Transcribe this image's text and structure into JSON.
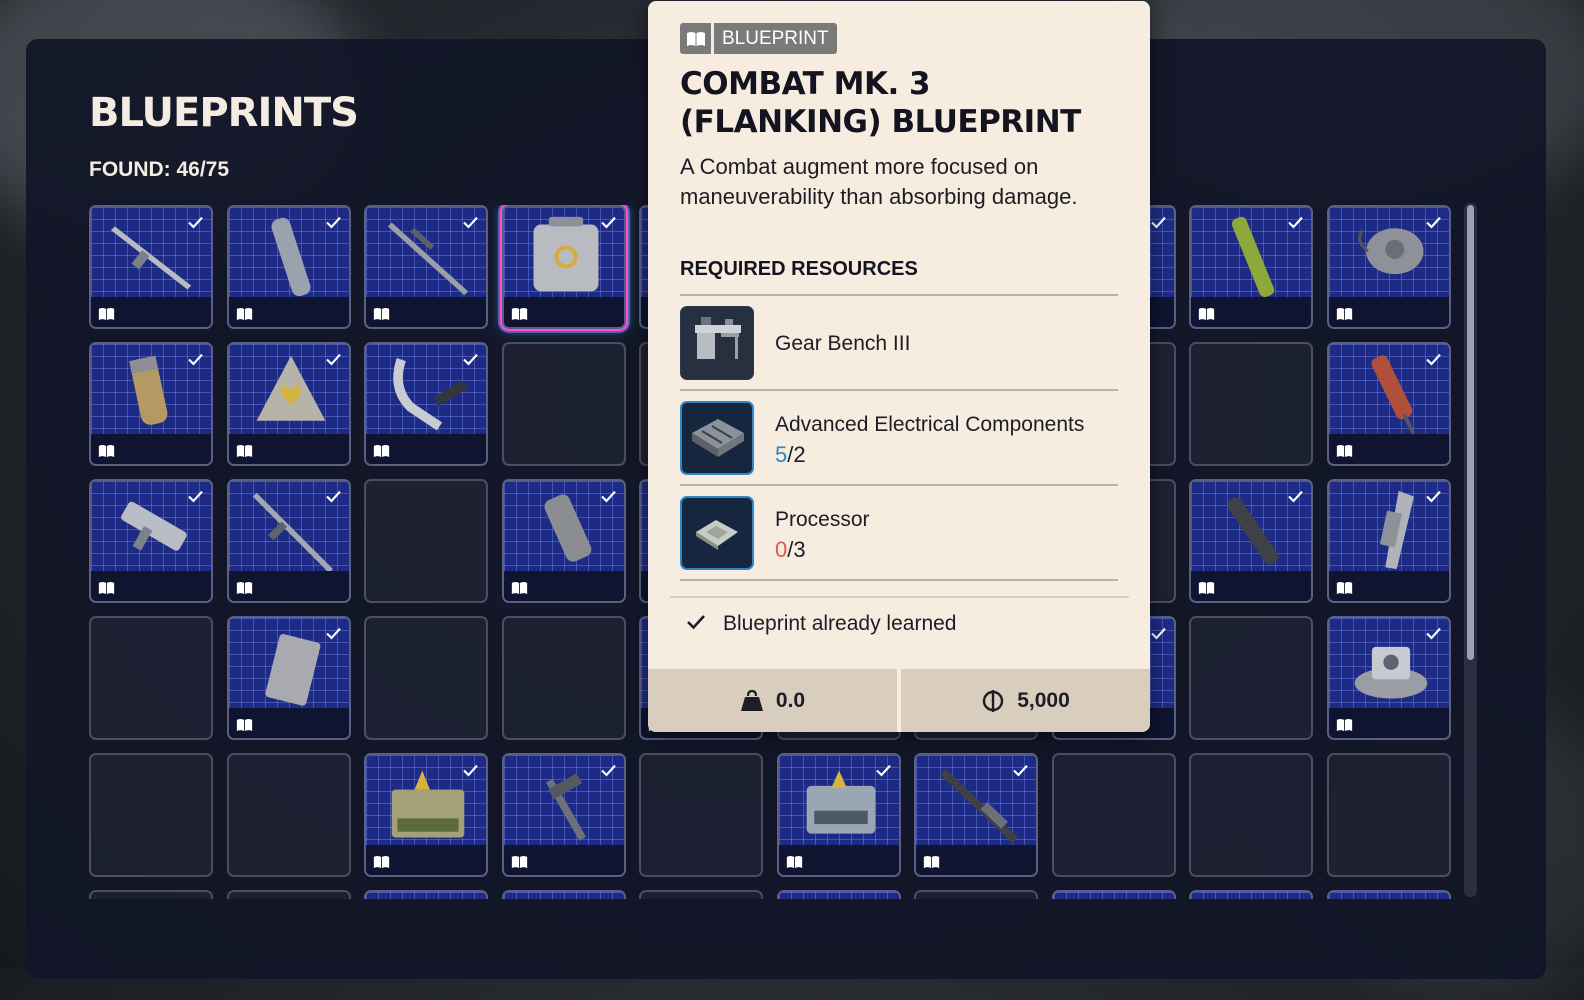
{
  "panel": {
    "title": "BLUEPRINTS",
    "found": "FOUND: 46/75"
  },
  "grid": {
    "cells": [
      {
        "state": "filled",
        "item": "rifle-item"
      },
      {
        "state": "filled",
        "item": "cylinder-item"
      },
      {
        "state": "filled",
        "item": "sniper-item"
      },
      {
        "state": "filled",
        "item": "augment-case-item",
        "selected": true
      },
      {
        "state": "filled",
        "item": "hidden"
      },
      {
        "state": "filled",
        "item": "hidden"
      },
      {
        "state": "filled",
        "item": "hidden"
      },
      {
        "state": "filled",
        "item": "hidden"
      },
      {
        "state": "filled",
        "item": "green-tube-item"
      },
      {
        "state": "filled",
        "item": "mine-item"
      },
      {
        "state": "filled",
        "item": "grenade-item"
      },
      {
        "state": "filled",
        "item": "heart-shield-item"
      },
      {
        "state": "filled",
        "item": "zipline-item"
      },
      {
        "state": "empty"
      },
      {
        "state": "empty"
      },
      {
        "state": "empty"
      },
      {
        "state": "empty"
      },
      {
        "state": "empty"
      },
      {
        "state": "empty"
      },
      {
        "state": "filled",
        "item": "syringe-item"
      },
      {
        "state": "filled",
        "item": "smg-item"
      },
      {
        "state": "filled",
        "item": "long-rifle-item"
      },
      {
        "state": "empty"
      },
      {
        "state": "filled",
        "item": "muzzle-item"
      },
      {
        "state": "filled",
        "item": "hidden"
      },
      {
        "state": "empty"
      },
      {
        "state": "empty"
      },
      {
        "state": "empty"
      },
      {
        "state": "filled",
        "item": "silencer-item"
      },
      {
        "state": "filled",
        "item": "stock-item"
      },
      {
        "state": "empty"
      },
      {
        "state": "filled",
        "item": "magazine-item"
      },
      {
        "state": "empty"
      },
      {
        "state": "empty"
      },
      {
        "state": "filled",
        "item": "hidden"
      },
      {
        "state": "empty"
      },
      {
        "state": "empty"
      },
      {
        "state": "filled",
        "item": "hidden"
      },
      {
        "state": "empty"
      },
      {
        "state": "filled",
        "item": "turret-item"
      },
      {
        "state": "empty"
      },
      {
        "state": "empty"
      },
      {
        "state": "filled",
        "item": "ammo-case-item"
      },
      {
        "state": "filled",
        "item": "hammer-item"
      },
      {
        "state": "empty"
      },
      {
        "state": "filled",
        "item": "tool-case-item"
      },
      {
        "state": "filled",
        "item": "shotgun-item"
      },
      {
        "state": "empty"
      },
      {
        "state": "empty"
      },
      {
        "state": "empty"
      }
    ]
  },
  "tooltip": {
    "tag": "BLUEPRINT",
    "tag_icon": "book-icon",
    "title": "COMBAT MK. 3 (FLANKING) BLUEPRINT",
    "description": "A Combat augment more focused on maneuverability than absorbing damage.",
    "required_label": "REQUIRED RESOURCES",
    "resources": [
      {
        "name": "Gear Bench III",
        "icon": "workbench-icon"
      },
      {
        "name": "Advanced Electrical Components",
        "have": "5",
        "need": "/2",
        "have_color": "#2f86c9",
        "icon": "circuit-tray-icon"
      },
      {
        "name": "Processor",
        "have": "0",
        "need": "/3",
        "have_color": "#e05a4a",
        "icon": "processor-chip-icon"
      }
    ],
    "learned_text": "Blueprint already learned",
    "weight": "0.0",
    "price": "5,000",
    "weight_icon": "weight-icon",
    "price_icon": "coin-icon"
  }
}
